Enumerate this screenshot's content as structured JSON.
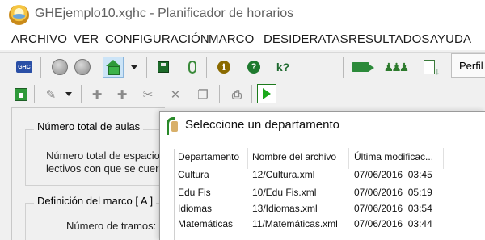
{
  "window": {
    "title": "GHEjemplo10.xghc - Planificador de horarios"
  },
  "menu": {
    "items": [
      "ARCHIVO",
      "VER",
      "CONFIGURACIÓN",
      "MARCO",
      "DESIDERATAS",
      "RESULTADOS",
      "AYUDA"
    ]
  },
  "toolbar1": {
    "ghc_label": "GHC",
    "help_glyph": "?",
    "info_glyph": "i",
    "perfil_label": "Perfil"
  },
  "panel": {
    "group1_title": "Número total de aulas",
    "group1_line1": "Número total de espacios",
    "group1_line2": "lectivos con que se cuer",
    "group2_title": "Definición del marco [ A ]",
    "tramos_label": "Número de tramos:"
  },
  "dialog": {
    "title": "Seleccione un departamento",
    "columns": [
      "Departamento",
      "Nombre del archivo",
      "Última modificac..."
    ],
    "rows": [
      [
        "Cultura",
        "12/Cultura.xml",
        "07/06/2016  03:45"
      ],
      [
        "Edu Fis",
        "10/Edu Fis.xml",
        "07/06/2016  05:19"
      ],
      [
        "Idiomas",
        "13/Idiomas.xml",
        "07/06/2016  03:54"
      ],
      [
        "Matemáticas",
        "11/Matemáticas.xml",
        "07/06/2016  03:44"
      ]
    ]
  },
  "colors": {
    "accent_green": "#1aa81a",
    "pressed_blue": "#cce4f7"
  }
}
